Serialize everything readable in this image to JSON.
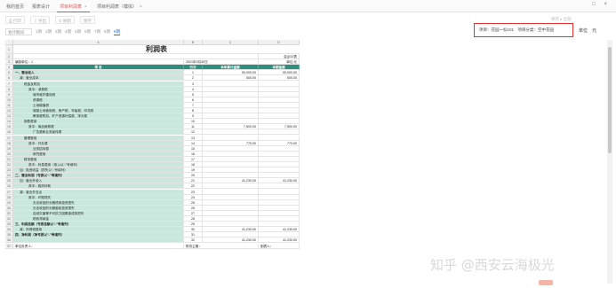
{
  "tabs": [
    {
      "label": "我的首页",
      "close": ""
    },
    {
      "label": "报表设计",
      "close": ""
    },
    {
      "label": "项目利润表",
      "close": "×"
    },
    {
      "label": "项目利润表（模拟）",
      "close": "×"
    }
  ],
  "window_controls": "□ ×",
  "toolbar": {
    "print": "打印",
    "export": "导出",
    "refresh": "刷新",
    "save": "保存",
    "right_label": "保存 ▸ 全部"
  },
  "period": {
    "select": "会计期间",
    "items": [
      "1期",
      "2期",
      "3期",
      "4期",
      "5期",
      "6期",
      "7期",
      "8期",
      "9期"
    ],
    "active": 8
  },
  "filter": {
    "text": "项目：花园一标101　项目分类：空中花园"
  },
  "unit": {
    "label": "单位",
    "value": "元"
  },
  "sheet": {
    "col_headers": [
      "A",
      "B",
      "C",
      "D"
    ],
    "title": "利润表",
    "form_no": "会企02表",
    "org": "编制单位：1",
    "date": "2021年9月30日",
    "unit": "单位:元",
    "head": [
      "项  目",
      "行次",
      "本年累计金额",
      "本期金额"
    ],
    "rows": [
      {
        "item": "一、营业收入",
        "no": "1",
        "c": "50,000.00",
        "d": "50,000.00",
        "lv": 0,
        "b": true
      },
      {
        "item": "减：营业成本",
        "no": "2",
        "c": "500.00",
        "d": "500.00",
        "lv": 1
      },
      {
        "item": "税金及附加",
        "no": "3",
        "c": "",
        "d": "",
        "lv": 2
      },
      {
        "item": "其中：消费税",
        "no": "4",
        "c": "",
        "d": "",
        "lv": 3
      },
      {
        "item": "城市维护建设税",
        "no": "5",
        "c": "",
        "d": "",
        "lv": 4
      },
      {
        "item": "资源税",
        "no": "6",
        "c": "",
        "d": "",
        "lv": 4
      },
      {
        "item": "土地增值税",
        "no": "7",
        "c": "",
        "d": "",
        "lv": 4
      },
      {
        "item": "城镇土地使用税、房产税、车船税、印花税",
        "no": "8",
        "c": "",
        "d": "",
        "lv": 4
      },
      {
        "item": "教育费附加、矿产资源补偿费、排污费",
        "no": "9",
        "c": "",
        "d": "",
        "lv": 4
      },
      {
        "item": "销售费用",
        "no": "10",
        "c": "",
        "d": "",
        "lv": 2
      },
      {
        "item": "其中：商品维修费",
        "no": "11",
        "c": "7,500.00",
        "d": "7,500.00",
        "lv": 3
      },
      {
        "item": "广告费和业务宣传费",
        "no": "12",
        "c": "",
        "d": "",
        "lv": 4
      },
      {
        "item": "管理费用",
        "no": "13",
        "c": "",
        "d": "",
        "lv": 2
      },
      {
        "item": "其中：开办费",
        "no": "14",
        "c": "770.00",
        "d": "770.00",
        "lv": 3
      },
      {
        "item": "业务招待费",
        "no": "15",
        "c": "",
        "d": "",
        "lv": 4
      },
      {
        "item": "研究费用",
        "no": "16",
        "c": "",
        "d": "",
        "lv": 4
      },
      {
        "item": "财务费用",
        "no": "17",
        "c": "",
        "d": "",
        "lv": 2
      },
      {
        "item": "其中：利息费用（收入以“-”号填列）",
        "no": "18",
        "c": "",
        "d": "",
        "lv": 3
      },
      {
        "item": "加：投资收益（损失以“-”号填列）",
        "no": "19",
        "c": "",
        "d": "",
        "lv": 1
      },
      {
        "item": "二、营业利润（亏损以“-”号填列）",
        "no": "20",
        "c": "",
        "d": "",
        "lv": 0,
        "b": true
      },
      {
        "item": "加：营业外收入",
        "no": "21",
        "c": "41,230.00",
        "d": "41,230.00",
        "lv": 1
      },
      {
        "item": "其中：政府补助",
        "no": "22",
        "c": "",
        "d": "",
        "lv": 3
      },
      {
        "item": "减：营业外支出",
        "no": "23",
        "c": "",
        "d": "",
        "lv": 1
      },
      {
        "item": "其中：坏账损失",
        "no": "24",
        "c": "",
        "d": "",
        "lv": 3
      },
      {
        "item": "无法收回的长期债券投资损失",
        "no": "25",
        "c": "",
        "d": "",
        "lv": 4
      },
      {
        "item": "无法收回的长期股权投资损失",
        "no": "26",
        "c": "",
        "d": "",
        "lv": 4
      },
      {
        "item": "自然灾害等不可抗力因素造成的损失",
        "no": "27",
        "c": "",
        "d": "",
        "lv": 4
      },
      {
        "item": "税收滞纳金",
        "no": "28",
        "c": "",
        "d": "",
        "lv": 4
      },
      {
        "item": "三、利润总额（亏损总额以“-”号填列）",
        "no": "29",
        "c": "",
        "d": "",
        "lv": 0,
        "b": true
      },
      {
        "item": "减：所得税费用",
        "no": "30",
        "c": "41,230.00",
        "d": "41,230.00",
        "lv": 1
      },
      {
        "item": "四、净利润（净亏损以“-”号填列）",
        "no": "31",
        "c": "",
        "d": "",
        "lv": 0,
        "b": true
      },
      {
        "item": "",
        "no": "32",
        "c": "41,230.00",
        "d": "41,230.00",
        "lv": 0
      }
    ],
    "footer": {
      "left": "单位负责人：",
      "mid": "财务主管：",
      "right": "制表人："
    }
  },
  "watermark": "知乎 @西安云海极光"
}
